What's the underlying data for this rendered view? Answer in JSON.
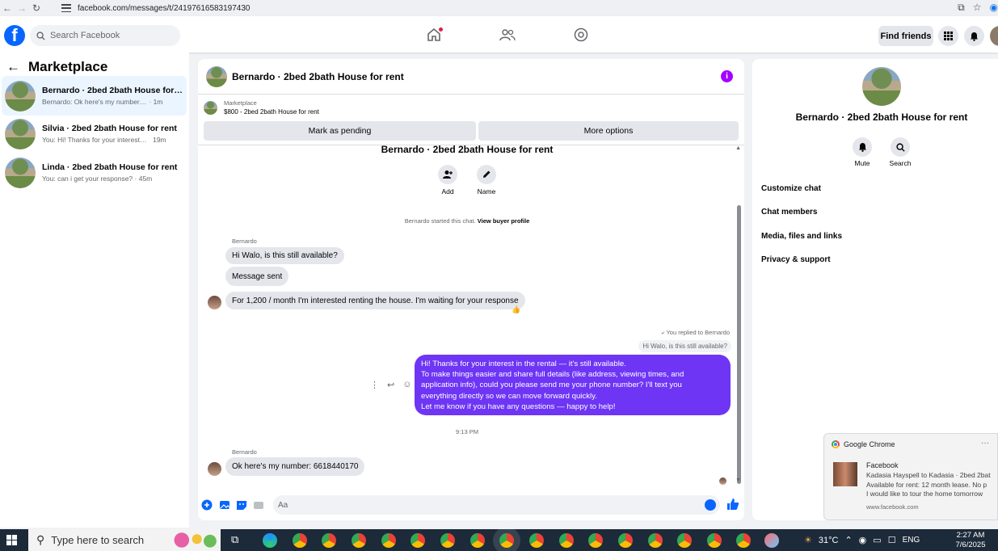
{
  "browser": {
    "url": "facebook.com/messages/t/24197616583197430"
  },
  "header": {
    "search_placeholder": "Search Facebook",
    "find_friends_label": "Find friends"
  },
  "sidebar": {
    "title": "Marketplace",
    "conversations": [
      {
        "name": "Bernardo · 2bed 2bath House for r...",
        "preview": "Bernardo: Ok here's my number: 661...",
        "time": "· 1m"
      },
      {
        "name": "Silvia · 2bed 2bath House for rent",
        "preview": "You: Hi! Thanks for your interest in t...",
        "time": "19m"
      },
      {
        "name": "Linda · 2bed 2bath House for rent",
        "preview": "You: can i get your response?",
        "time": "· 45m"
      }
    ]
  },
  "chat": {
    "title": "Bernardo · 2bed 2bath House for rent",
    "listing_label": "Marketplace",
    "listing_detail": "$800 - 2bed 2bath House for rent",
    "mark_pending_label": "Mark as pending",
    "more_options_label": "More options",
    "thread_title": "Bernardo · 2bed 2bath House for rent",
    "add_label": "Add",
    "name_label": "Name",
    "started_text": "Bernardo started this chat.",
    "view_profile_label": "View buyer profile",
    "sender_name": "Bernardo",
    "messages_in": [
      "Hi Walo, is this still available?",
      "Message sent",
      "For 1,200 / month I'm interested renting the house. I'm waiting for your response"
    ],
    "reaction": "👍",
    "reply_note": "You replied to Bernardo",
    "quoted_text": "Hi Walo, is this still available?",
    "own_message_lines": [
      "Hi! Thanks for your interest in the rental — it's still available.",
      "To make things easier and share full details (like address, viewing times, and",
      "application info), could you please send me your phone number? I'll text you",
      "everything directly so we can move forward quickly.",
      "Let me know if you have any questions — happy to help!"
    ],
    "timestamp": "9:13 PM",
    "last_message": "Ok here's my number: 6618440170",
    "composer_placeholder": "Aa"
  },
  "info_panel": {
    "title": "Bernardo · 2bed 2bath House for rent",
    "mute_label": "Mute",
    "search_label": "Search",
    "sections": [
      "Customize chat",
      "Chat members",
      "Media, files and links",
      "Privacy & support"
    ]
  },
  "notification": {
    "app": "Google Chrome",
    "title": "Facebook",
    "body_lines": [
      "Kadasia Hayspell to Kadasia · 2bed 2bat",
      "Available for rent: 12 month lease. No p",
      "I would like to tour the home tomorrow"
    ],
    "site": "www.facebook.com"
  },
  "taskbar": {
    "search_placeholder": "Type here to search",
    "temperature": "31°C",
    "language": "ENG",
    "time": "2:27 AM",
    "date": "7/6/2025"
  },
  "colors": {
    "brand": "#0866ff",
    "own_bubble": "#6e35f5",
    "info_accent": "#a200ff"
  }
}
